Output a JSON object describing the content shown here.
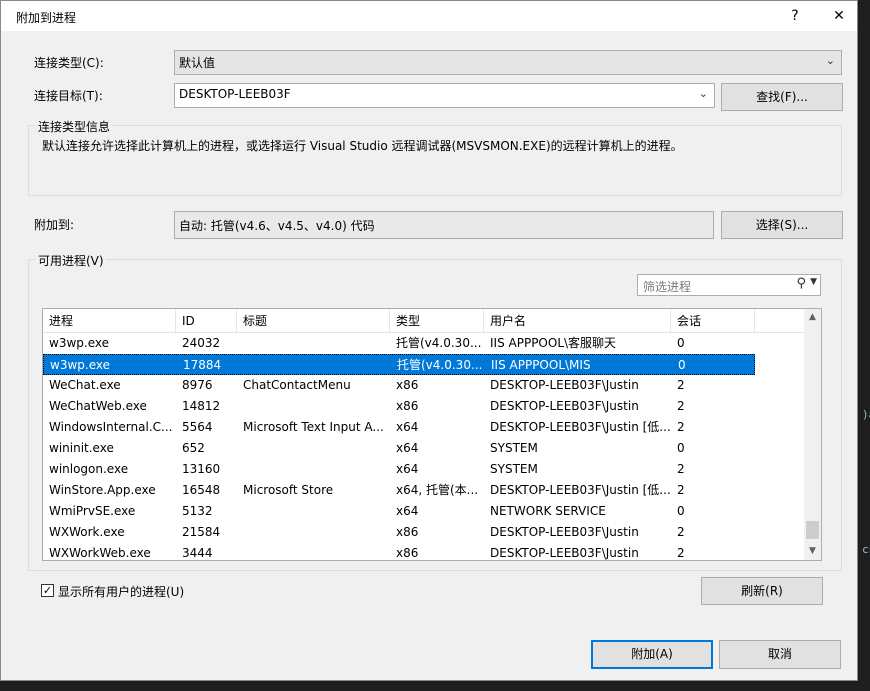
{
  "window": {
    "title": "附加到进程",
    "help": "?",
    "close": "✕"
  },
  "connection_type": {
    "label": "连接类型(C):",
    "value": "默认值"
  },
  "connection_target": {
    "label": "连接目标(T):",
    "value": "DESKTOP-LEEB03F",
    "find_button": "查找(F)..."
  },
  "connection_info": {
    "title": "连接类型信息",
    "text": "默认连接允许选择此计算机上的进程，或选择运行 Visual Studio 远程调试器(MSVSMON.EXE)的远程计算机上的进程。"
  },
  "attach_to": {
    "label": "附加到:",
    "value": "自动: 托管(v4.6、v4.5、v4.0) 代码",
    "select_button": "选择(S)..."
  },
  "available": {
    "title": "可用进程(V)",
    "filter_placeholder": "筛选进程",
    "columns": [
      "进程",
      "ID",
      "标题",
      "类型",
      "用户名",
      "会话"
    ],
    "rows": [
      [
        "w3wp.exe",
        "24032",
        "",
        "托管(v4.0.30...",
        "IIS APPPOOL\\客服聊天",
        "0"
      ],
      [
        "w3wp.exe",
        "17884",
        "",
        "托管(v4.0.30...",
        "IIS APPPOOL\\MIS",
        "0"
      ],
      [
        "WeChat.exe",
        "8976",
        "ChatContactMenu",
        "x86",
        "DESKTOP-LEEB03F\\Justin",
        "2"
      ],
      [
        "WeChatWeb.exe",
        "14812",
        "",
        "x86",
        "DESKTOP-LEEB03F\\Justin",
        "2"
      ],
      [
        "WindowsInternal.C...",
        "5564",
        "Microsoft Text Input A...",
        "x64",
        "DESKTOP-LEEB03F\\Justin [低...",
        "2"
      ],
      [
        "wininit.exe",
        "652",
        "",
        "x64",
        "SYSTEM",
        "0"
      ],
      [
        "winlogon.exe",
        "13160",
        "",
        "x64",
        "SYSTEM",
        "2"
      ],
      [
        "WinStore.App.exe",
        "16548",
        "Microsoft Store",
        "x64, 托管(本...",
        "DESKTOP-LEEB03F\\Justin [低...",
        "2"
      ],
      [
        "WmiPrvSE.exe",
        "5132",
        "",
        "x64",
        "NETWORK SERVICE",
        "0"
      ],
      [
        "WXWork.exe",
        "21584",
        "",
        "x86",
        "DESKTOP-LEEB03F\\Justin",
        "2"
      ],
      [
        "WXWorkWeb.exe",
        "3444",
        "",
        "x86",
        "DESKTOP-LEEB03F\\Justin",
        "2"
      ]
    ],
    "selected_row": 1
  },
  "show_all_users": {
    "label": "显示所有用户的进程(U)",
    "checked": true,
    "check_mark": "✓"
  },
  "refresh_button": "刷新(R)",
  "attach_button": "附加(A)",
  "cancel_button": "取消",
  "icons": {
    "dropdown": "chevron-down-icon",
    "search": "search-icon"
  },
  "colors": {
    "selection": "#0078d7",
    "primary_border": "#0078d7"
  }
}
